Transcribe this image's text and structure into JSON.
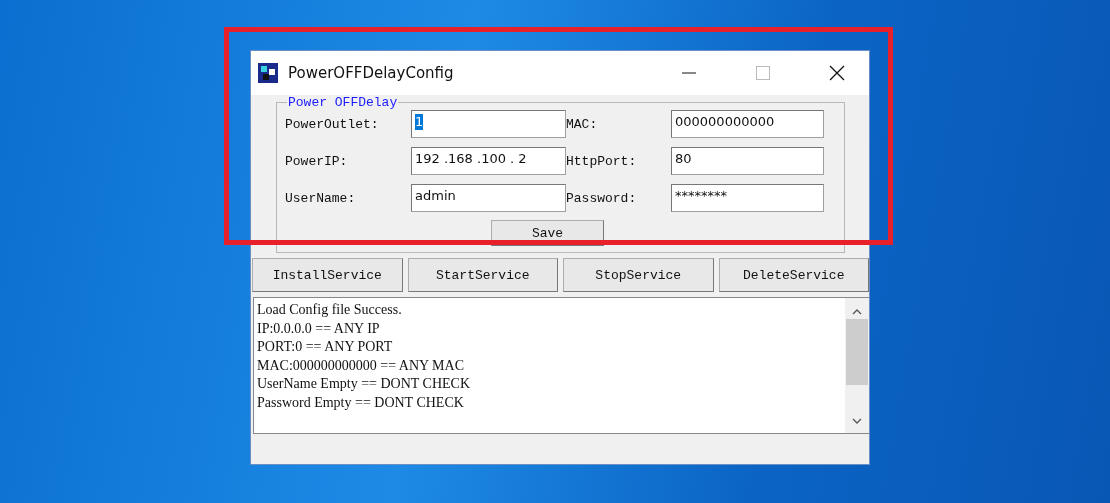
{
  "window": {
    "title": "PowerOFFDelayConfig"
  },
  "group": {
    "title": "Power OFFDelay",
    "fields": [
      {
        "label": "PowerOutlet:",
        "value": "1",
        "text_selected": true
      },
      {
        "label": "MAC:",
        "value": "000000000000",
        "text_selected": false
      },
      {
        "label": "PowerIP:",
        "value": "192 .168 .100 . 2",
        "text_selected": false
      },
      {
        "label": "HttpPort:",
        "value": "80",
        "text_selected": false
      },
      {
        "label": "UserName:",
        "value": "admin",
        "text_selected": false
      },
      {
        "label": "Password:",
        "value": "********",
        "text_selected": false
      }
    ],
    "save_button": "Save"
  },
  "service_buttons": [
    "InstallService",
    "StartService",
    "StopService",
    "DeleteService"
  ],
  "log": [
    "Load Config file Success.",
    "IP:0.0.0.0 == ANY IP",
    "PORT:0 == ANY PORT",
    "MAC:000000000000 == ANY MAC",
    "UserName Empty == DONT CHECK",
    "Password Empty == DONT CHECK"
  ]
}
